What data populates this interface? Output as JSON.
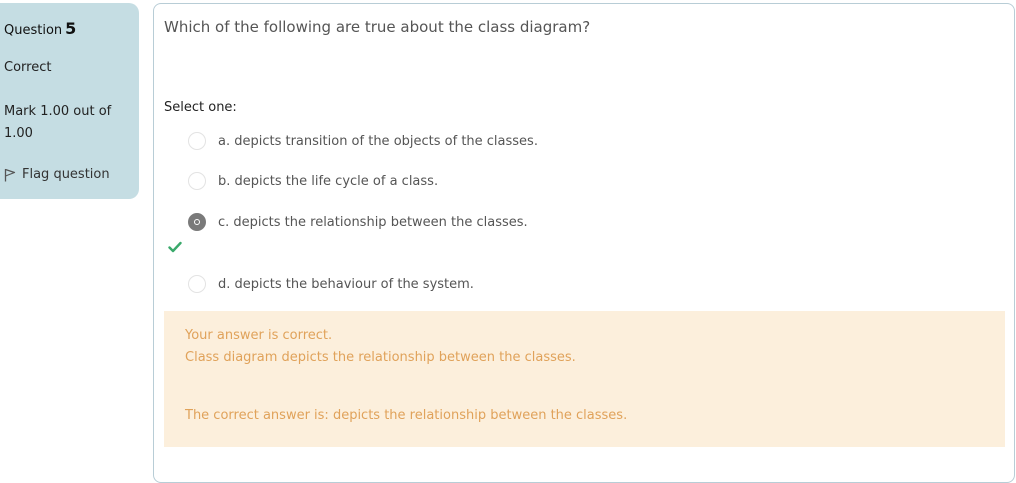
{
  "info": {
    "question_word": "Question",
    "question_number": "5",
    "state": "Correct",
    "grade": "Mark 1.00 out of 1.00",
    "flag_label": "Flag question"
  },
  "question": {
    "text": "Which of the following are true about the class diagram?",
    "prompt": "Select one:",
    "options": [
      {
        "label": "a. depicts transition of the objects of the classes.",
        "selected": false
      },
      {
        "label": "b. depicts the life cycle of a class.",
        "selected": false
      },
      {
        "label": "c. depicts the relationship between the classes.",
        "selected": true
      },
      {
        "label": "d. depicts the behaviour of the system.",
        "selected": false
      }
    ]
  },
  "feedback": {
    "result": "Your answer is correct.",
    "explanation": "Class diagram depicts the relationship between the classes.",
    "right_answer": "The correct answer is: depicts the relationship between the classes."
  },
  "colors": {
    "panel_bg": "#c5dde3",
    "feedback_bg": "#fcefdc",
    "feedback_text": "#e0a25a",
    "correct_check": "#3aa96b"
  }
}
